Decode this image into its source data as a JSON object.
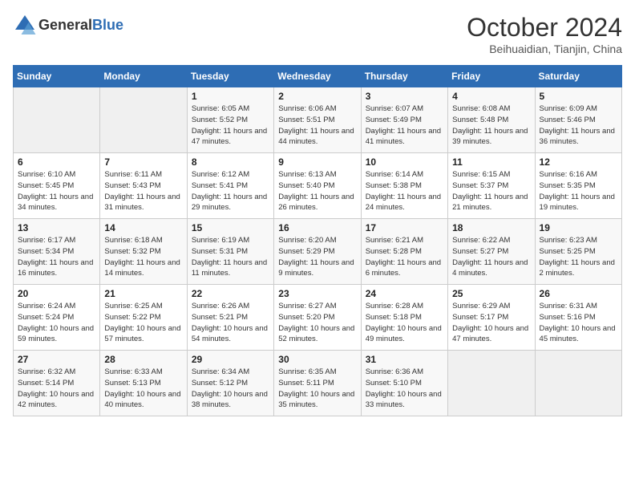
{
  "header": {
    "logo_general": "General",
    "logo_blue": "Blue",
    "month": "October 2024",
    "location": "Beihuaidian, Tianjin, China"
  },
  "days_of_week": [
    "Sunday",
    "Monday",
    "Tuesday",
    "Wednesday",
    "Thursday",
    "Friday",
    "Saturday"
  ],
  "weeks": [
    [
      {
        "day": "",
        "info": ""
      },
      {
        "day": "",
        "info": ""
      },
      {
        "day": "1",
        "info": "Sunrise: 6:05 AM\nSunset: 5:52 PM\nDaylight: 11 hours and 47 minutes."
      },
      {
        "day": "2",
        "info": "Sunrise: 6:06 AM\nSunset: 5:51 PM\nDaylight: 11 hours and 44 minutes."
      },
      {
        "day": "3",
        "info": "Sunrise: 6:07 AM\nSunset: 5:49 PM\nDaylight: 11 hours and 41 minutes."
      },
      {
        "day": "4",
        "info": "Sunrise: 6:08 AM\nSunset: 5:48 PM\nDaylight: 11 hours and 39 minutes."
      },
      {
        "day": "5",
        "info": "Sunrise: 6:09 AM\nSunset: 5:46 PM\nDaylight: 11 hours and 36 minutes."
      }
    ],
    [
      {
        "day": "6",
        "info": "Sunrise: 6:10 AM\nSunset: 5:45 PM\nDaylight: 11 hours and 34 minutes."
      },
      {
        "day": "7",
        "info": "Sunrise: 6:11 AM\nSunset: 5:43 PM\nDaylight: 11 hours and 31 minutes."
      },
      {
        "day": "8",
        "info": "Sunrise: 6:12 AM\nSunset: 5:41 PM\nDaylight: 11 hours and 29 minutes."
      },
      {
        "day": "9",
        "info": "Sunrise: 6:13 AM\nSunset: 5:40 PM\nDaylight: 11 hours and 26 minutes."
      },
      {
        "day": "10",
        "info": "Sunrise: 6:14 AM\nSunset: 5:38 PM\nDaylight: 11 hours and 24 minutes."
      },
      {
        "day": "11",
        "info": "Sunrise: 6:15 AM\nSunset: 5:37 PM\nDaylight: 11 hours and 21 minutes."
      },
      {
        "day": "12",
        "info": "Sunrise: 6:16 AM\nSunset: 5:35 PM\nDaylight: 11 hours and 19 minutes."
      }
    ],
    [
      {
        "day": "13",
        "info": "Sunrise: 6:17 AM\nSunset: 5:34 PM\nDaylight: 11 hours and 16 minutes."
      },
      {
        "day": "14",
        "info": "Sunrise: 6:18 AM\nSunset: 5:32 PM\nDaylight: 11 hours and 14 minutes."
      },
      {
        "day": "15",
        "info": "Sunrise: 6:19 AM\nSunset: 5:31 PM\nDaylight: 11 hours and 11 minutes."
      },
      {
        "day": "16",
        "info": "Sunrise: 6:20 AM\nSunset: 5:29 PM\nDaylight: 11 hours and 9 minutes."
      },
      {
        "day": "17",
        "info": "Sunrise: 6:21 AM\nSunset: 5:28 PM\nDaylight: 11 hours and 6 minutes."
      },
      {
        "day": "18",
        "info": "Sunrise: 6:22 AM\nSunset: 5:27 PM\nDaylight: 11 hours and 4 minutes."
      },
      {
        "day": "19",
        "info": "Sunrise: 6:23 AM\nSunset: 5:25 PM\nDaylight: 11 hours and 2 minutes."
      }
    ],
    [
      {
        "day": "20",
        "info": "Sunrise: 6:24 AM\nSunset: 5:24 PM\nDaylight: 10 hours and 59 minutes."
      },
      {
        "day": "21",
        "info": "Sunrise: 6:25 AM\nSunset: 5:22 PM\nDaylight: 10 hours and 57 minutes."
      },
      {
        "day": "22",
        "info": "Sunrise: 6:26 AM\nSunset: 5:21 PM\nDaylight: 10 hours and 54 minutes."
      },
      {
        "day": "23",
        "info": "Sunrise: 6:27 AM\nSunset: 5:20 PM\nDaylight: 10 hours and 52 minutes."
      },
      {
        "day": "24",
        "info": "Sunrise: 6:28 AM\nSunset: 5:18 PM\nDaylight: 10 hours and 49 minutes."
      },
      {
        "day": "25",
        "info": "Sunrise: 6:29 AM\nSunset: 5:17 PM\nDaylight: 10 hours and 47 minutes."
      },
      {
        "day": "26",
        "info": "Sunrise: 6:31 AM\nSunset: 5:16 PM\nDaylight: 10 hours and 45 minutes."
      }
    ],
    [
      {
        "day": "27",
        "info": "Sunrise: 6:32 AM\nSunset: 5:14 PM\nDaylight: 10 hours and 42 minutes."
      },
      {
        "day": "28",
        "info": "Sunrise: 6:33 AM\nSunset: 5:13 PM\nDaylight: 10 hours and 40 minutes."
      },
      {
        "day": "29",
        "info": "Sunrise: 6:34 AM\nSunset: 5:12 PM\nDaylight: 10 hours and 38 minutes."
      },
      {
        "day": "30",
        "info": "Sunrise: 6:35 AM\nSunset: 5:11 PM\nDaylight: 10 hours and 35 minutes."
      },
      {
        "day": "31",
        "info": "Sunrise: 6:36 AM\nSunset: 5:10 PM\nDaylight: 10 hours and 33 minutes."
      },
      {
        "day": "",
        "info": ""
      },
      {
        "day": "",
        "info": ""
      }
    ]
  ]
}
